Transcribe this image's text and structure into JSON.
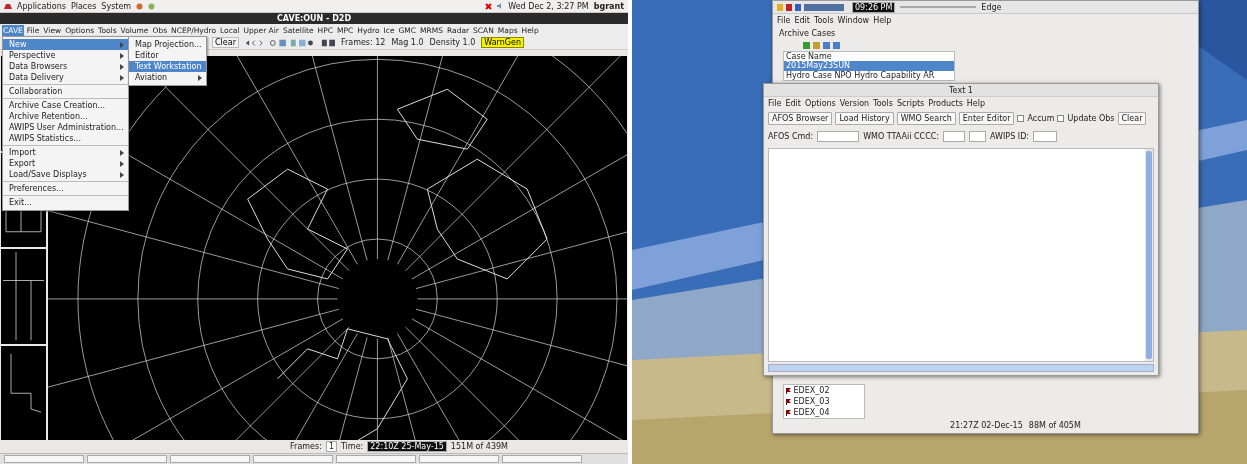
{
  "left_desktop": {
    "top_panel": {
      "menus": [
        "Applications",
        "Places",
        "System"
      ],
      "clock": "Wed Dec  2,  3:27 PM",
      "user": "bgrant"
    },
    "window": {
      "title": "CAVE:OUN - D2D",
      "menu_bar": [
        {
          "label": "CAVE",
          "selected": true
        },
        {
          "label": "File",
          "selected": false
        },
        {
          "label": "View",
          "selected": false
        },
        {
          "label": "Options",
          "selected": false
        },
        {
          "label": "Tools",
          "selected": false
        },
        {
          "label": "Volume",
          "selected": false
        },
        {
          "label": "Obs",
          "selected": false
        },
        {
          "label": "NCEP/Hydro",
          "selected": false
        },
        {
          "label": "Local",
          "selected": false
        },
        {
          "label": "Upper Air",
          "selected": false
        },
        {
          "label": "Satellite",
          "selected": false
        },
        {
          "label": "HPC",
          "selected": false
        },
        {
          "label": "MPC",
          "selected": false
        },
        {
          "label": "Hydro",
          "selected": false
        },
        {
          "label": "Ice",
          "selected": false
        },
        {
          "label": "GMC",
          "selected": false
        },
        {
          "label": "MRMS",
          "selected": false
        },
        {
          "label": "Radar",
          "selected": false
        },
        {
          "label": "SCAN",
          "selected": false
        },
        {
          "label": "Maps",
          "selected": false
        },
        {
          "label": "Help",
          "selected": false
        }
      ],
      "toolbar": {
        "clear": "Clear",
        "frames": "Frames: 12",
        "mag": "Mag 1.0",
        "density": "Density 1.0",
        "warngen": "WarnGen"
      },
      "cave_menu": [
        [
          {
            "label": "New",
            "submenu": true,
            "selected": true
          },
          {
            "label": "Perspective",
            "submenu": true,
            "selected": false
          },
          {
            "label": "Data Browsers",
            "submenu": true,
            "selected": false
          },
          {
            "label": "Data Delivery",
            "submenu": true,
            "selected": false
          }
        ],
        [
          {
            "label": "Collaboration",
            "submenu": false,
            "selected": false
          }
        ],
        [
          {
            "label": "Archive Case Creation...",
            "submenu": false,
            "selected": false
          },
          {
            "label": "Archive Retention...",
            "submenu": false,
            "selected": false
          },
          {
            "label": "AWIPS User Administration...",
            "submenu": false,
            "selected": false
          },
          {
            "label": "AWIPS Statistics...",
            "submenu": false,
            "selected": false
          }
        ],
        [
          {
            "label": "Import",
            "submenu": true,
            "selected": false
          },
          {
            "label": "Export",
            "submenu": true,
            "selected": false
          },
          {
            "label": "Load/Save Displays",
            "submenu": true,
            "selected": false
          }
        ],
        [
          {
            "label": "Preferences...",
            "submenu": false,
            "selected": false
          }
        ],
        [
          {
            "label": "Exit...",
            "submenu": false,
            "selected": false
          }
        ]
      ],
      "new_submenu": [
        {
          "label": "Map Projection...",
          "submenu": false,
          "selected": false
        },
        {
          "label": "Editor",
          "submenu": false,
          "selected": false
        },
        {
          "label": "Text Workstation",
          "submenu": false,
          "selected": true
        },
        {
          "label": "Aviation",
          "submenu": true,
          "selected": false
        }
      ],
      "status": {
        "frames_label": "Frames:",
        "frames": "1",
        "time_label": "Time:",
        "time": "22:10Z 25-May-15",
        "memory": "151M of 439M"
      }
    }
  },
  "right_desktop": {
    "top_panel": {
      "clock": "09:26 PM"
    },
    "back_window": {
      "title": "Edge",
      "menu_bar": [
        "File",
        "Edit",
        "Tools",
        "Window",
        "Help"
      ],
      "view_tab": "Archive Cases",
      "list_header": "Case Name",
      "cases": [
        {
          "label": "2015May23SUN",
          "selected": true
        },
        {
          "label": "Hydro Case NPO Hydro Capability AR",
          "selected": false
        }
      ],
      "servers": [
        "EDEX_02",
        "EDEX_03",
        "EDEX_04"
      ],
      "time": "21:27Z 02-Dec-15",
      "memory": "88M of 405M"
    },
    "text_window": {
      "title": "Text 1",
      "menu_bar": [
        "File",
        "Edit",
        "Options",
        "Version",
        "Tools",
        "Scripts",
        "Products",
        "Help"
      ],
      "buttons": [
        {
          "kind": "button",
          "label": "AFOS Browser"
        },
        {
          "kind": "button",
          "label": "Load History"
        },
        {
          "kind": "button",
          "label": "WMO Search"
        },
        {
          "kind": "button",
          "label": "Enter Editor"
        },
        {
          "kind": "checkbox",
          "label": "Accum",
          "checked": false
        },
        {
          "kind": "checkbox",
          "label": "Update Obs",
          "checked": false
        },
        {
          "kind": "button",
          "label": "Clear"
        }
      ],
      "afos_label": "AFOS Cmd:",
      "wmo_label": "WMO TTAAii CCCC:",
      "awips_label": "AWIPS ID:"
    }
  }
}
